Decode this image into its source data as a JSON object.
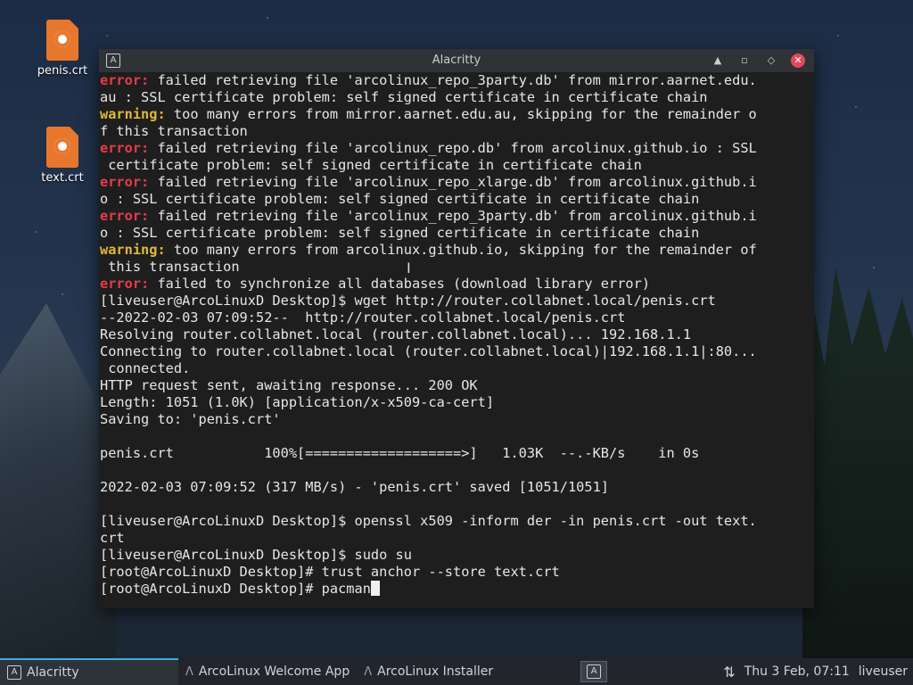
{
  "desktop": {
    "icons": [
      {
        "label": "penis.crt"
      },
      {
        "label": "text.crt"
      }
    ]
  },
  "window": {
    "title": "Alacritty",
    "app_icon": "A",
    "buttons": {
      "up": "▲",
      "restore": "◇",
      "minimize": "▫",
      "close": "✕"
    }
  },
  "terminal": {
    "lines": [
      {
        "kind": "err",
        "tag": "error:",
        "text": " failed retrieving file 'arcolinux_repo_3party.db' from mirror.aarnet.edu."
      },
      {
        "kind": "plain",
        "text": "au : SSL certificate problem: self signed certificate in certificate chain"
      },
      {
        "kind": "warn",
        "tag": "warning:",
        "text": " too many errors from mirror.aarnet.edu.au, skipping for the remainder o"
      },
      {
        "kind": "plain",
        "text": "f this transaction"
      },
      {
        "kind": "err",
        "tag": "error:",
        "text": " failed retrieving file 'arcolinux_repo.db' from arcolinux.github.io : SSL"
      },
      {
        "kind": "plain",
        "text": " certificate problem: self signed certificate in certificate chain"
      },
      {
        "kind": "err",
        "tag": "error:",
        "text": " failed retrieving file 'arcolinux_repo_xlarge.db' from arcolinux.github.i"
      },
      {
        "kind": "plain",
        "text": "o : SSL certificate problem: self signed certificate in certificate chain"
      },
      {
        "kind": "err",
        "tag": "error:",
        "text": " failed retrieving file 'arcolinux_repo_3party.db' from arcolinux.github.i"
      },
      {
        "kind": "plain",
        "text": "o : SSL certificate problem: self signed certificate in certificate chain"
      },
      {
        "kind": "warn",
        "tag": "warning:",
        "text": " too many errors from arcolinux.github.io, skipping for the remainder of"
      },
      {
        "kind": "plain",
        "text": " this transaction"
      },
      {
        "kind": "err",
        "tag": "error:",
        "text": " failed to synchronize all databases (download library error)"
      },
      {
        "kind": "plain",
        "text": "[liveuser@ArcoLinuxD Desktop]$ wget http://router.collabnet.local/penis.crt"
      },
      {
        "kind": "plain",
        "text": "--2022-02-03 07:09:52--  http://router.collabnet.local/penis.crt"
      },
      {
        "kind": "plain",
        "text": "Resolving router.collabnet.local (router.collabnet.local)... 192.168.1.1"
      },
      {
        "kind": "plain",
        "text": "Connecting to router.collabnet.local (router.collabnet.local)|192.168.1.1|:80..."
      },
      {
        "kind": "plain",
        "text": " connected."
      },
      {
        "kind": "plain",
        "text": "HTTP request sent, awaiting response... 200 OK"
      },
      {
        "kind": "plain",
        "text": "Length: 1051 (1.0K) [application/x-x509-ca-cert]"
      },
      {
        "kind": "plain",
        "text": "Saving to: 'penis.crt'"
      },
      {
        "kind": "plain",
        "text": ""
      },
      {
        "kind": "plain",
        "text": "penis.crt           100%[===================>]   1.03K  --.-KB/s    in 0s"
      },
      {
        "kind": "plain",
        "text": ""
      },
      {
        "kind": "plain",
        "text": "2022-02-03 07:09:52 (317 MB/s) - 'penis.crt' saved [1051/1051]"
      },
      {
        "kind": "plain",
        "text": ""
      },
      {
        "kind": "plain",
        "text": "[liveuser@ArcoLinuxD Desktop]$ openssl x509 -inform der -in penis.crt -out text."
      },
      {
        "kind": "plain",
        "text": "crt"
      },
      {
        "kind": "plain",
        "text": "[liveuser@ArcoLinuxD Desktop]$ sudo su"
      },
      {
        "kind": "plain",
        "text": "[root@ArcoLinuxD Desktop]# trust anchor --store text.crt"
      },
      {
        "kind": "prompt",
        "text": "[root@ArcoLinuxD Desktop]# pacman"
      }
    ]
  },
  "taskbar": {
    "tasks": [
      {
        "label": "Alacritty",
        "active": true
      },
      {
        "label": "ArcoLinux Welcome App",
        "active": false
      },
      {
        "label": "ArcoLinux Installer",
        "active": false
      }
    ],
    "pager_glyph": "A",
    "network_glyph": "⇅",
    "clock": "Thu  3 Feb, 07:11",
    "user": "liveuser"
  },
  "colors": {
    "error": "#e53c4a",
    "warning": "#e0b83a",
    "terminal_bg": "#1e1e1e",
    "accent": "#3daee9",
    "close": "#e0495a"
  }
}
